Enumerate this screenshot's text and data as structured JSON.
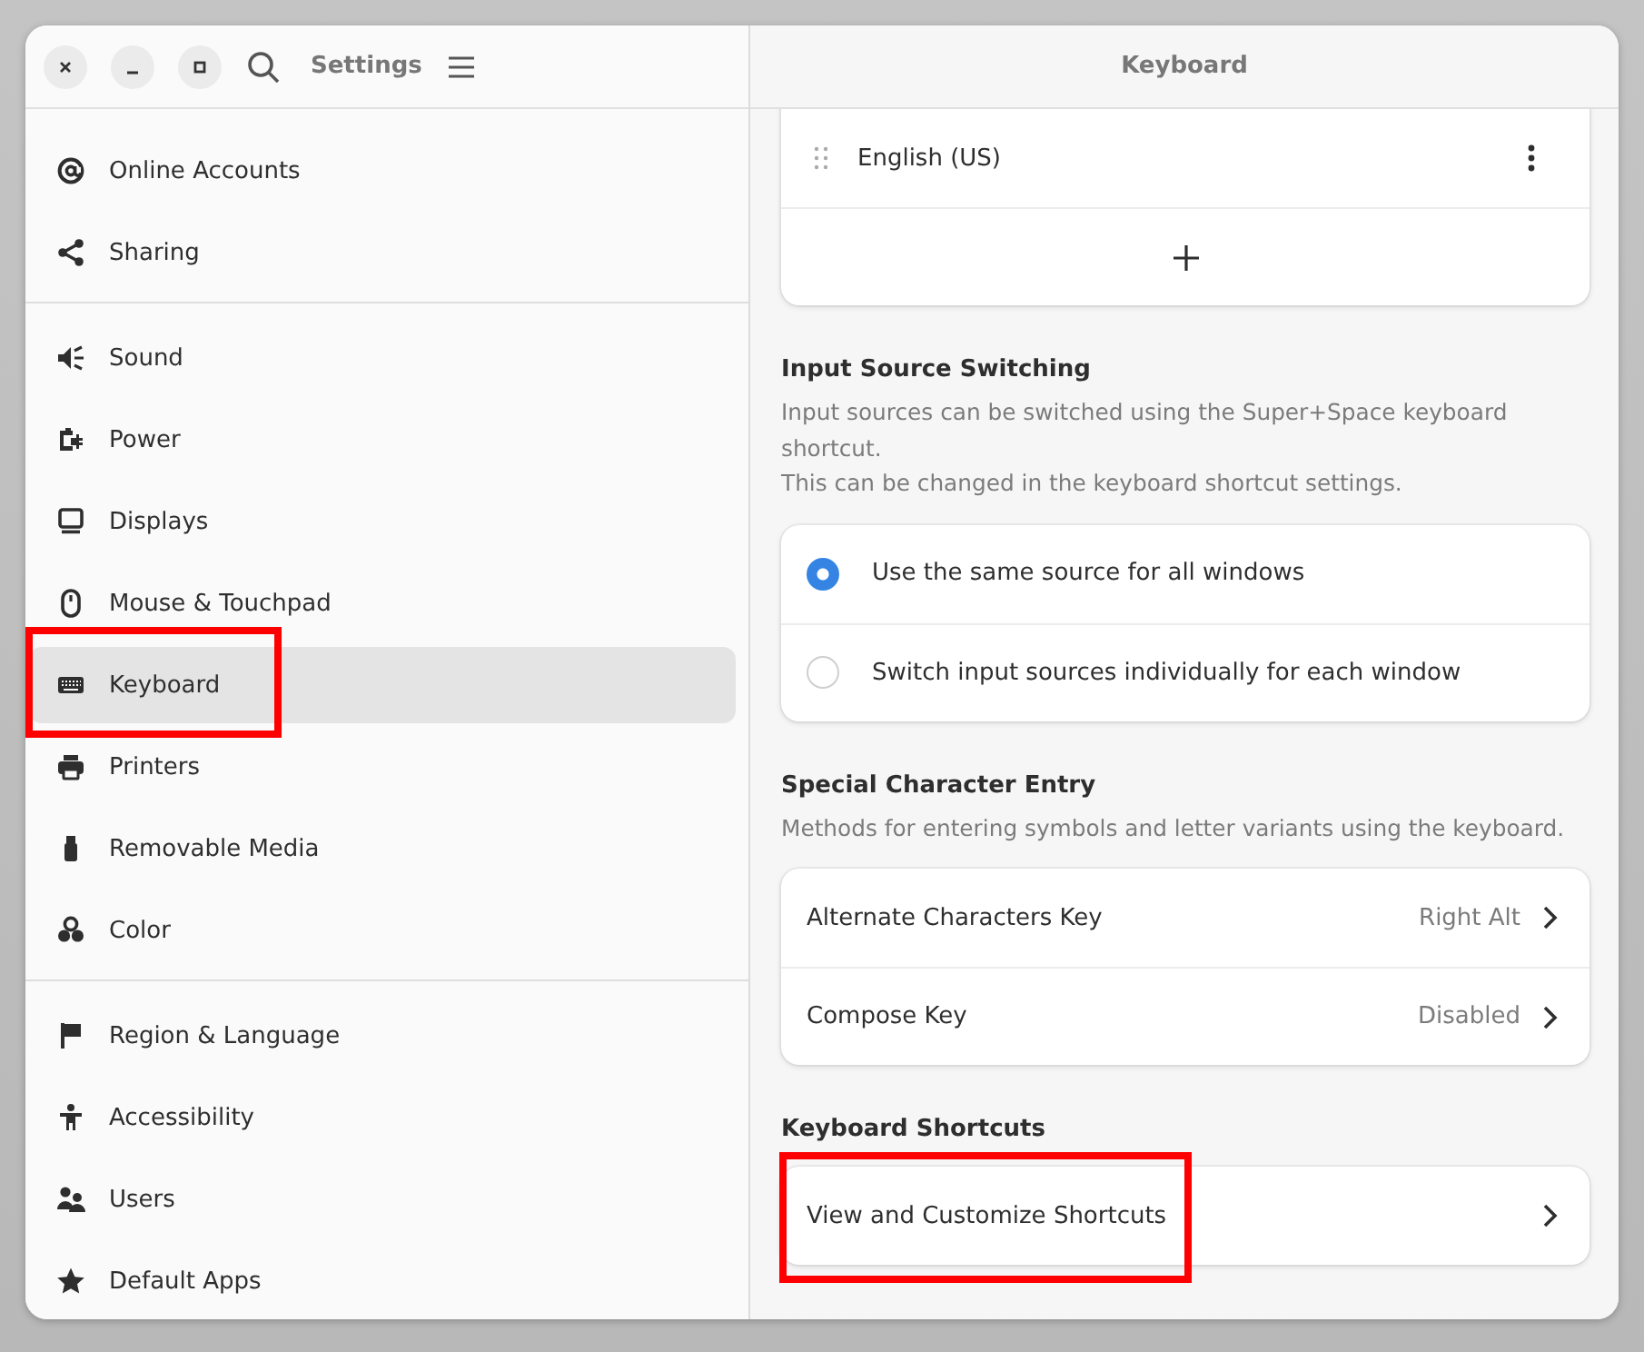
{
  "window": {
    "title": "Settings",
    "pane_title": "Keyboard"
  },
  "sidebar": {
    "groups": [
      [
        {
          "label": "Online Accounts",
          "selected": false,
          "highlighted": false
        },
        {
          "label": "Sharing",
          "selected": false,
          "highlighted": false
        }
      ],
      [
        {
          "label": "Sound",
          "selected": false,
          "highlighted": false
        },
        {
          "label": "Power",
          "selected": false,
          "highlighted": false
        },
        {
          "label": "Displays",
          "selected": false,
          "highlighted": false
        },
        {
          "label": "Mouse & Touchpad",
          "selected": false,
          "highlighted": false
        },
        {
          "label": "Keyboard",
          "selected": true,
          "highlighted": true
        },
        {
          "label": "Printers",
          "selected": false,
          "highlighted": false
        },
        {
          "label": "Removable Media",
          "selected": false,
          "highlighted": false
        },
        {
          "label": "Color",
          "selected": false,
          "highlighted": false
        }
      ],
      [
        {
          "label": "Region & Language",
          "selected": false,
          "highlighted": false
        },
        {
          "label": "Accessibility",
          "selected": false,
          "highlighted": false
        },
        {
          "label": "Users",
          "selected": false,
          "highlighted": false
        },
        {
          "label": "Default Apps",
          "selected": false,
          "highlighted": false
        }
      ]
    ]
  },
  "input_sources": [
    {
      "label": "English (US)"
    }
  ],
  "input_source_switching": {
    "heading": "Input Source Switching",
    "description": [
      "Input sources can be switched using the Super+Space keyboard shortcut.",
      "This can be changed in the keyboard shortcut settings."
    ],
    "options": [
      {
        "label": "Use the same source for all windows",
        "selected": true
      },
      {
        "label": "Switch input sources individually for each window",
        "selected": false
      }
    ]
  },
  "special_character_entry": {
    "heading": "Special Character Entry",
    "description": [
      "Methods for entering symbols and letter variants using the keyboard."
    ],
    "rows": [
      {
        "label": "Alternate Characters Key",
        "value": "Right Alt",
        "highlighted": false
      },
      {
        "label": "Compose Key",
        "value": "Disabled",
        "highlighted": false
      }
    ]
  },
  "keyboard_shortcuts": {
    "heading": "Keyboard Shortcuts",
    "rows": [
      {
        "label": "View and Customize Shortcuts",
        "highlighted": true
      }
    ]
  }
}
